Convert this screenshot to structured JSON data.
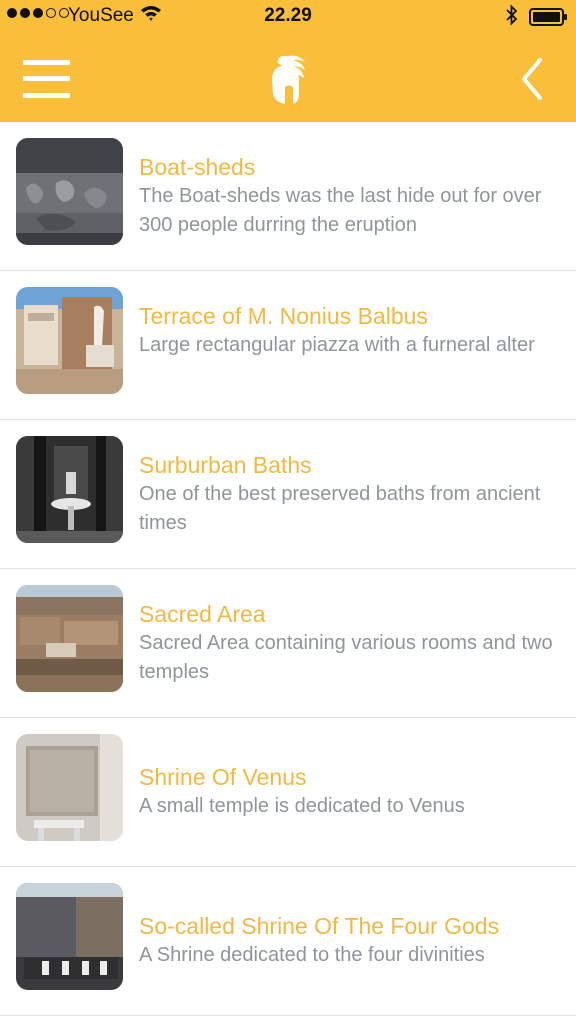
{
  "status_bar": {
    "carrier": "YouSee",
    "time": "22.29",
    "signal_bars_filled": 3,
    "signal_bars_total": 5
  },
  "header": {
    "background_color": "#f9be3a",
    "menu_icon": "hamburger-icon",
    "logo_icon": "spartan-helmet-icon",
    "back_icon": "chevron-left-icon"
  },
  "places": [
    {
      "title": "Boat-sheds",
      "description": "The Boat-sheds was the last hide out for over 300 people durring the eruption"
    },
    {
      "title": "Terrace of M. Nonius Balbus",
      "description": "Large rectangular piazza with a furneral alter"
    },
    {
      "title": "Surburban Baths",
      "description": "One of the best preserved baths from ancient times"
    },
    {
      "title": "Sacred Area",
      "description": "Sacred Area containing various rooms and two temples"
    },
    {
      "title": "Shrine Of Venus",
      "description": "A small temple is dedicated to Venus"
    },
    {
      "title": "So-called Shrine Of The Four Gods",
      "description": "A Shrine dedicated to the four divinities"
    }
  ],
  "colors": {
    "title": "#f3b83f",
    "description": "#8f959b"
  }
}
